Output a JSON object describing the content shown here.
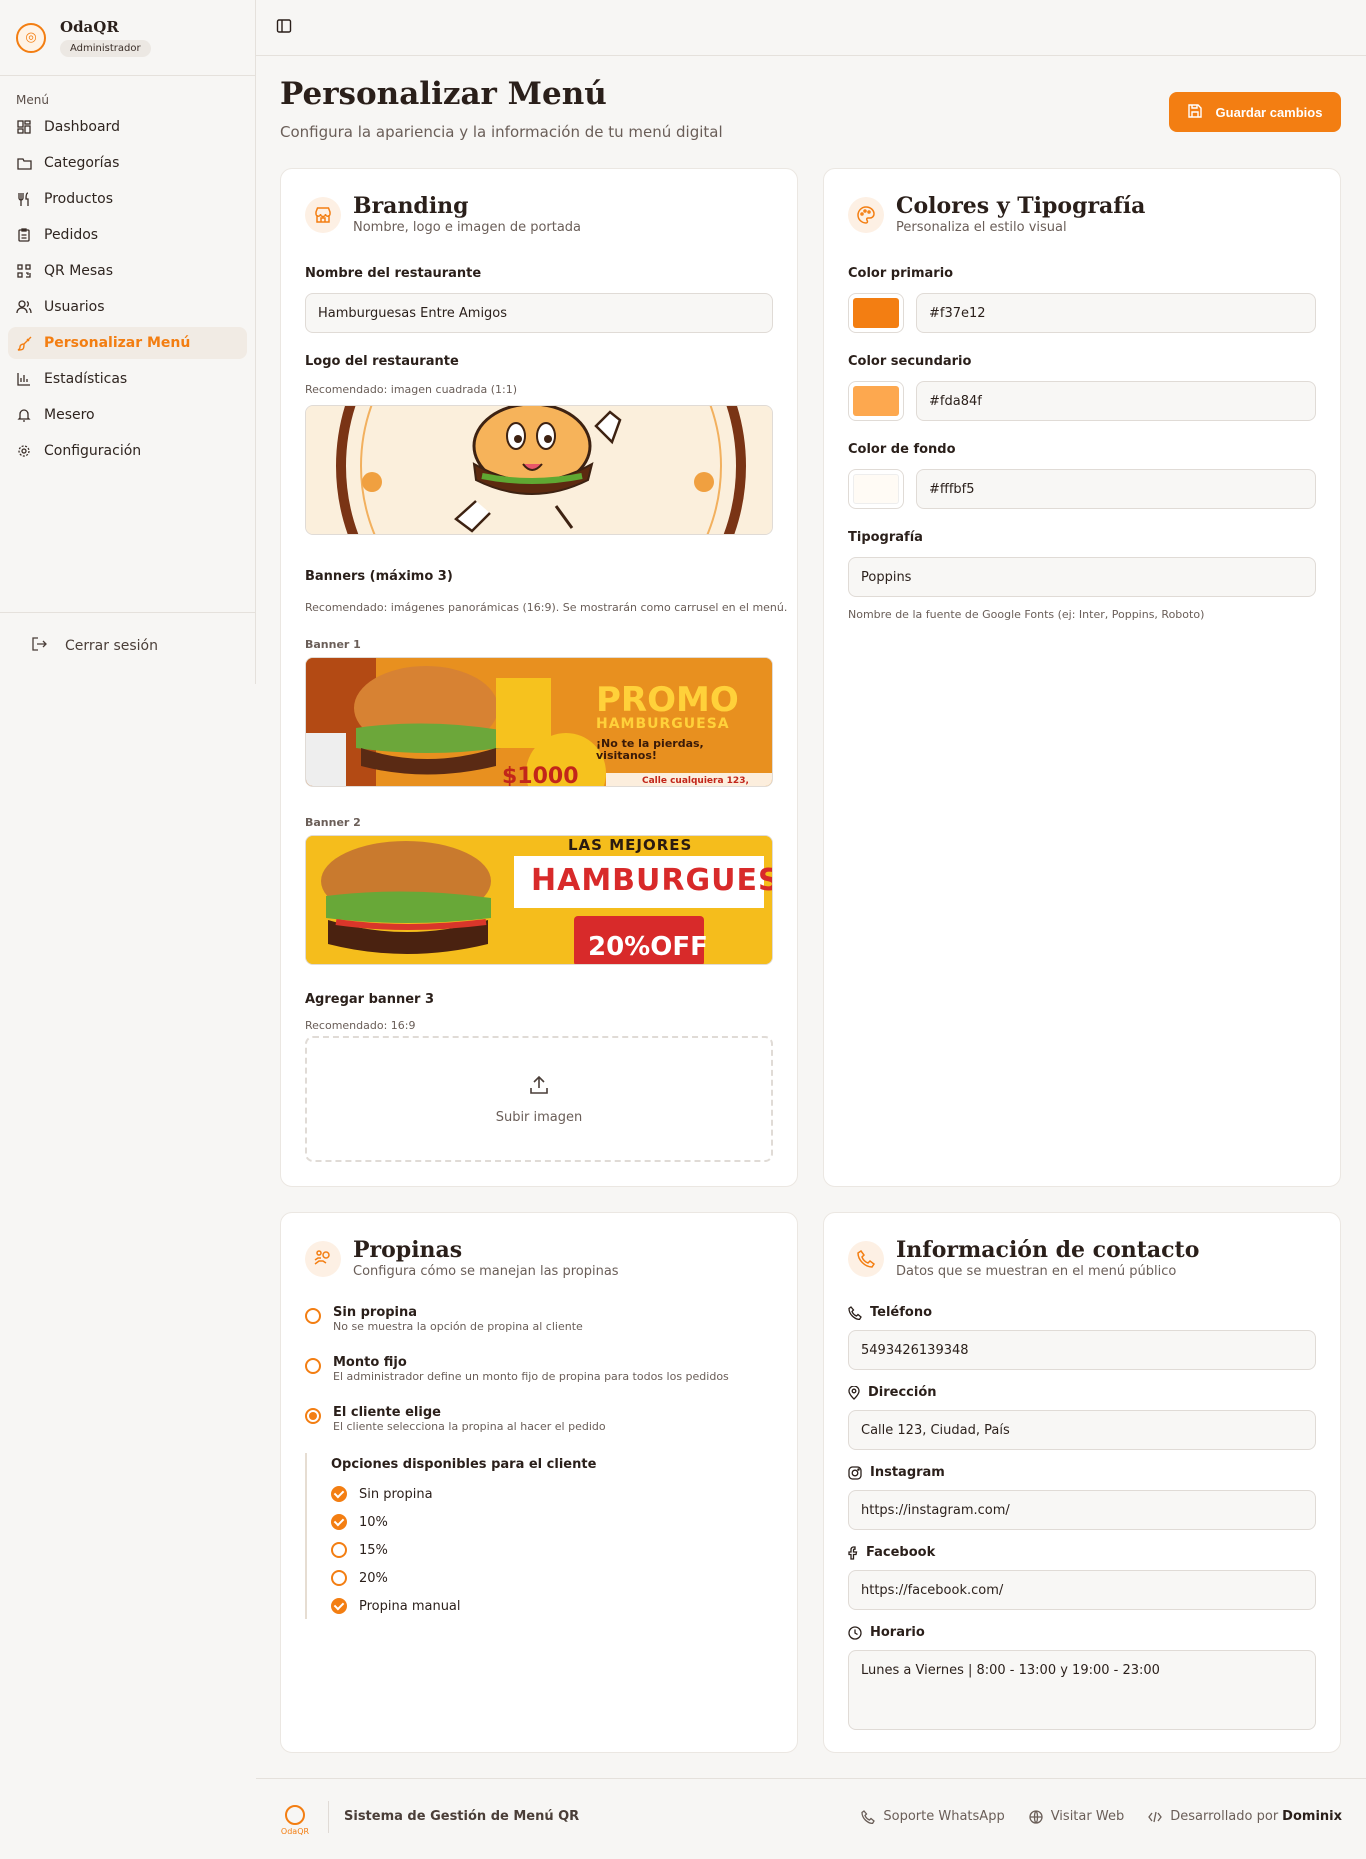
{
  "app": {
    "name": "OdaQR",
    "role": "Administrador"
  },
  "sidebar": {
    "section": "Menú",
    "items": [
      {
        "label": "Dashboard"
      },
      {
        "label": "Categorías"
      },
      {
        "label": "Productos"
      },
      {
        "label": "Pedidos"
      },
      {
        "label": "QR Mesas"
      },
      {
        "label": "Usuarios"
      },
      {
        "label": "Personalizar Menú"
      },
      {
        "label": "Estadísticas"
      },
      {
        "label": "Mesero"
      },
      {
        "label": "Configuración"
      }
    ],
    "logout": "Cerrar sesión"
  },
  "header": {
    "title": "Personalizar Menú",
    "subtitle": "Configura la apariencia y la información de tu menú digital",
    "save": "Guardar cambios"
  },
  "branding": {
    "title": "Branding",
    "subtitle": "Nombre, logo e imagen de portada",
    "name_label": "Nombre del restaurante",
    "name_value": "Hamburguesas Entre Amigos",
    "logo_label": "Logo del restaurante",
    "logo_hint": "Recomendado: imagen cuadrada (1:1)",
    "banners_label": "Banners (máximo 3)",
    "banners_hint": "Recomendado: imágenes panorámicas (16:9). Se mostrarán como carrusel en el menú.",
    "banner1_label": "Banner 1",
    "banner1": {
      "promo": "PROMO",
      "sub": "HAMBURGUESA",
      "tag": "¡No te la pierdas, visitanos!",
      "price": "$1000",
      "addr": "Calle cualquiera 123,"
    },
    "banner2_label": "Banner 2",
    "banner2": {
      "top": "LAS MEJORES",
      "main": "HAMBURGUESAS",
      "off": "20%OFF"
    },
    "banner3_label": "Agregar banner 3",
    "banner3_hint": "Recomendado: 16:9",
    "upload": "Subir imagen"
  },
  "colors": {
    "title": "Colores y Tipografía",
    "subtitle": "Personaliza el estilo visual",
    "primary_label": "Color primario",
    "primary": "#f37e12",
    "secondary_label": "Color secundario",
    "secondary": "#fda84f",
    "background_label": "Color de fondo",
    "background": "#fffbf5",
    "font_label": "Tipografía",
    "font_value": "Poppins",
    "font_hint": "Nombre de la fuente de Google Fonts (ej: Inter, Poppins, Roboto)"
  },
  "tips": {
    "title": "Propinas",
    "subtitle": "Configura cómo se manejan las propinas",
    "options": [
      {
        "title": "Sin propina",
        "desc": "No se muestra la opción de propina al cliente"
      },
      {
        "title": "Monto fijo",
        "desc": "El administrador define un monto fijo de propina para todos los pedidos"
      },
      {
        "title": "El cliente elige",
        "desc": "El cliente selecciona la propina al hacer el pedido"
      }
    ],
    "client_head": "Opciones disponibles para el cliente",
    "client_options": [
      {
        "label": "Sin propina",
        "checked": true
      },
      {
        "label": "10%",
        "checked": true
      },
      {
        "label": "15%",
        "checked": false
      },
      {
        "label": "20%",
        "checked": false
      },
      {
        "label": "Propina manual",
        "checked": true
      }
    ]
  },
  "contact": {
    "title": "Información de contacto",
    "subtitle": "Datos que se muestran en el menú público",
    "phone_label": "Teléfono",
    "phone": "5493426139348",
    "address_label": "Dirección",
    "address": "Calle 123, Ciudad, País",
    "instagram_label": "Instagram",
    "instagram": "https://instagram.com/",
    "facebook_label": "Facebook",
    "facebook": "https://facebook.com/",
    "hours_label": "Horario",
    "hours": "Lunes a Viernes | 8:00 - 13:00 y 19:00 - 23:00"
  },
  "footer": {
    "logo": "OdaQR",
    "system": "Sistema de Gestión de Menú QR",
    "whatsapp": "Soporte WhatsApp",
    "web": "Visitar Web",
    "dev_prefix": "Desarrollado por",
    "dev_name": "Dominix"
  }
}
